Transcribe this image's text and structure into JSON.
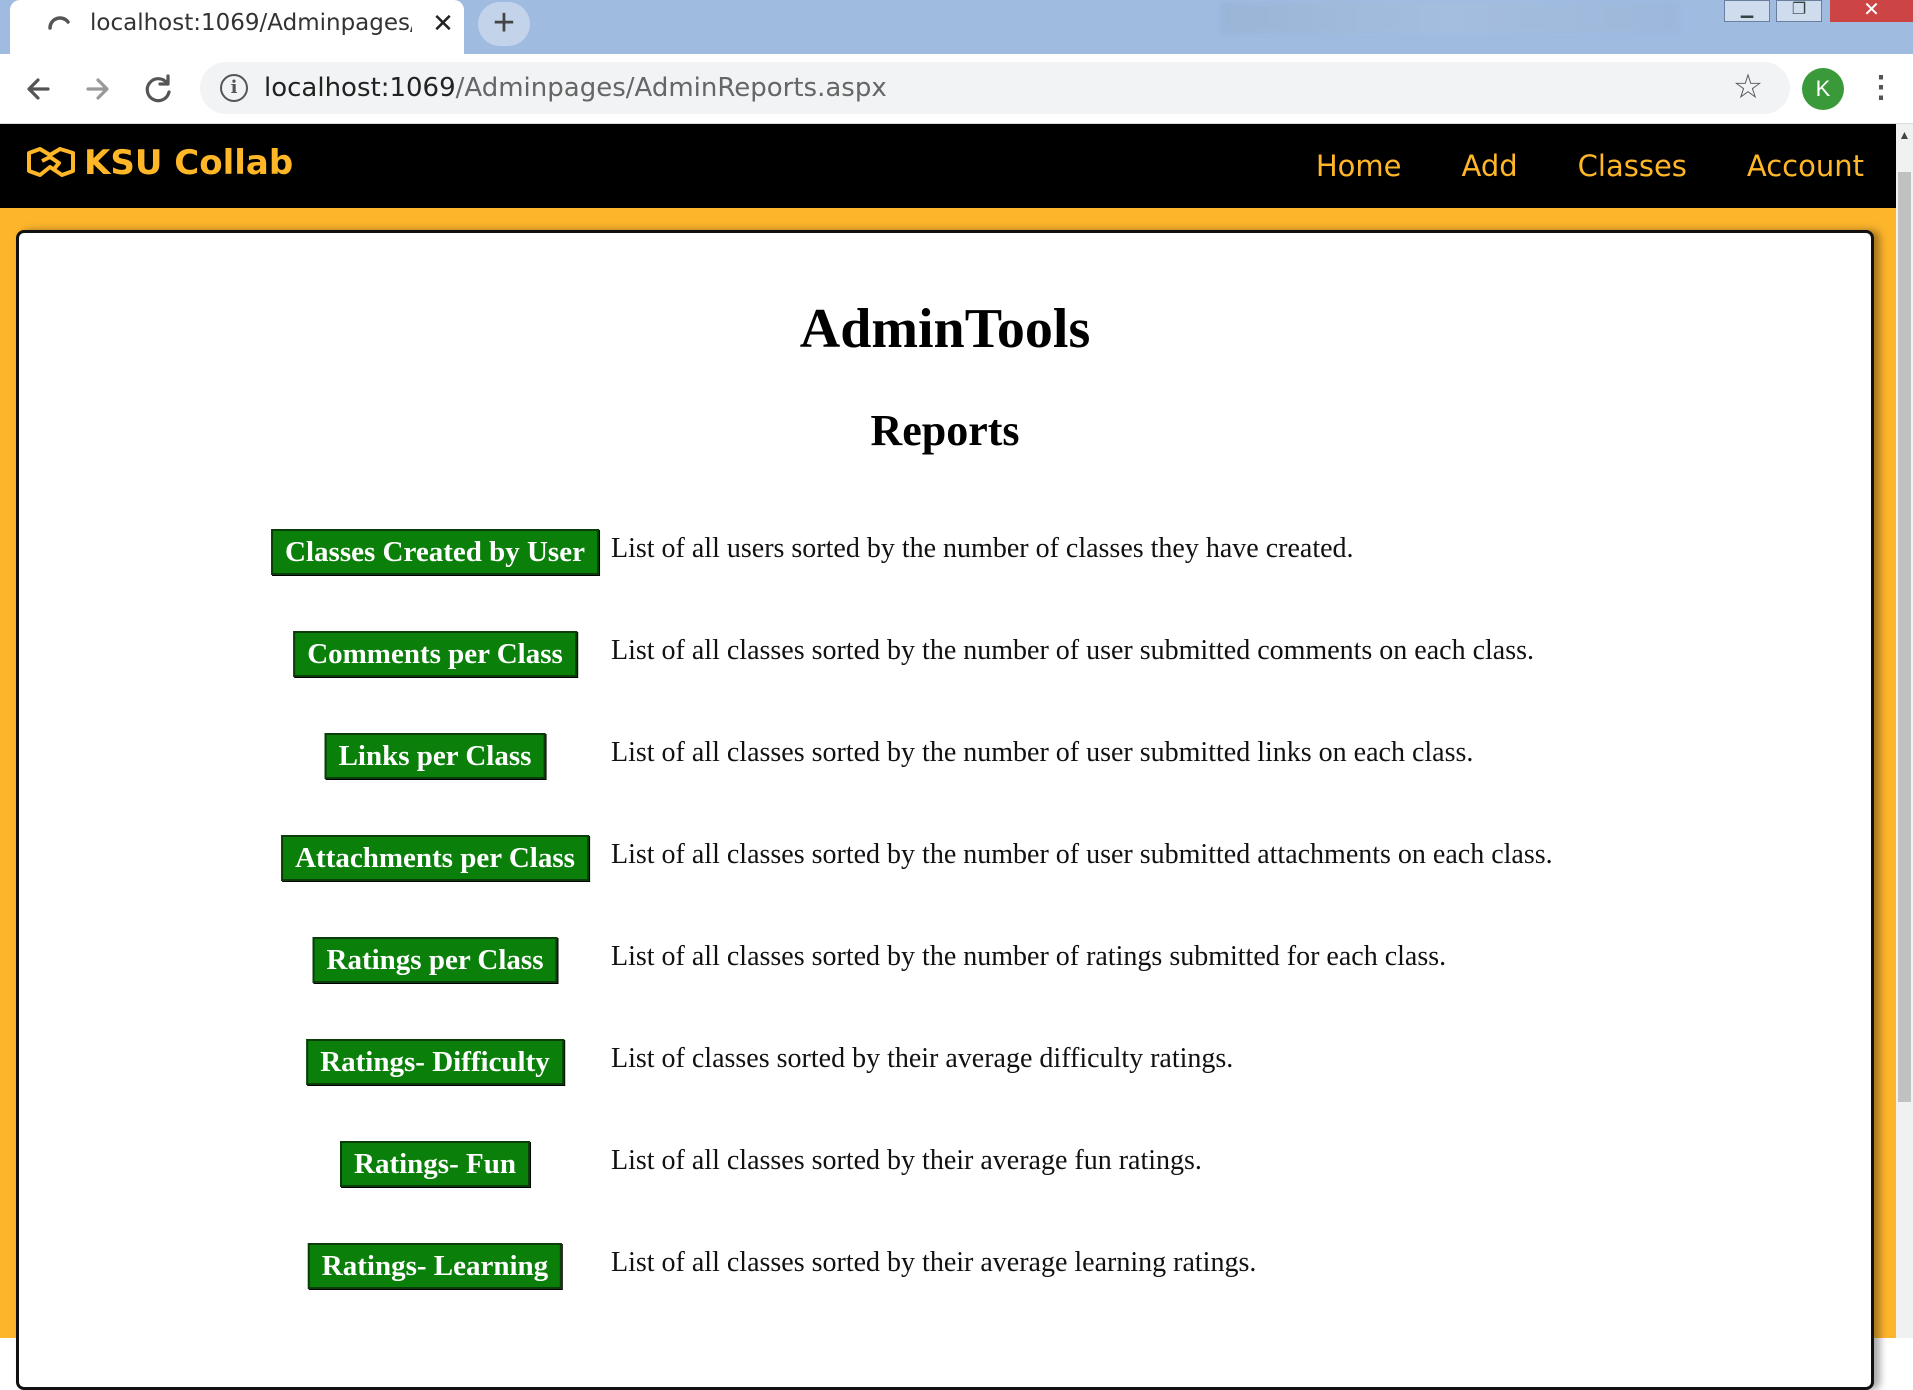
{
  "browser": {
    "tab_title": "localhost:1069/Adminpages/Adn",
    "tab_close": "✕",
    "new_tab": "+",
    "url_host": "localhost:1069",
    "url_path": "/Adminpages/AdminReports.aspx",
    "profile_initial": "K",
    "icons": [
      "loading-icon",
      "back-icon",
      "forward-icon",
      "reload-icon",
      "info-icon",
      "star-icon",
      "menu-icon"
    ]
  },
  "site": {
    "brand": "KSU Collab",
    "nav": [
      "Home",
      "Add",
      "Classes",
      "Account"
    ],
    "accent_color": "#ffb627",
    "header_color": "#000000",
    "page_bg_color": "#fdb52c"
  },
  "page": {
    "title": "AdminTools",
    "section_title": "Reports",
    "button_color": "#0a7f0a",
    "reports": [
      {
        "label": "Classes Created by User",
        "description": "List of all users sorted by the number of classes they have created."
      },
      {
        "label": "Comments per Class",
        "description": "List of all classes sorted by the number of user submitted comments on each class."
      },
      {
        "label": "Links per Class",
        "description": "List of all classes sorted by the number of user submitted links on each class."
      },
      {
        "label": "Attachments per Class",
        "description": "List of all classes sorted by the number of user submitted attachments on each class."
      },
      {
        "label": "Ratings per Class",
        "description": "List of all classes sorted by the number of ratings submitted for each class."
      },
      {
        "label": "Ratings- Difficulty",
        "description": "List of classes sorted by their average difficulty ratings."
      },
      {
        "label": "Ratings- Fun",
        "description": "List of all classes sorted by their average fun ratings."
      },
      {
        "label": "Ratings- Learning",
        "description": "List of all classes sorted by their average learning ratings."
      }
    ]
  }
}
